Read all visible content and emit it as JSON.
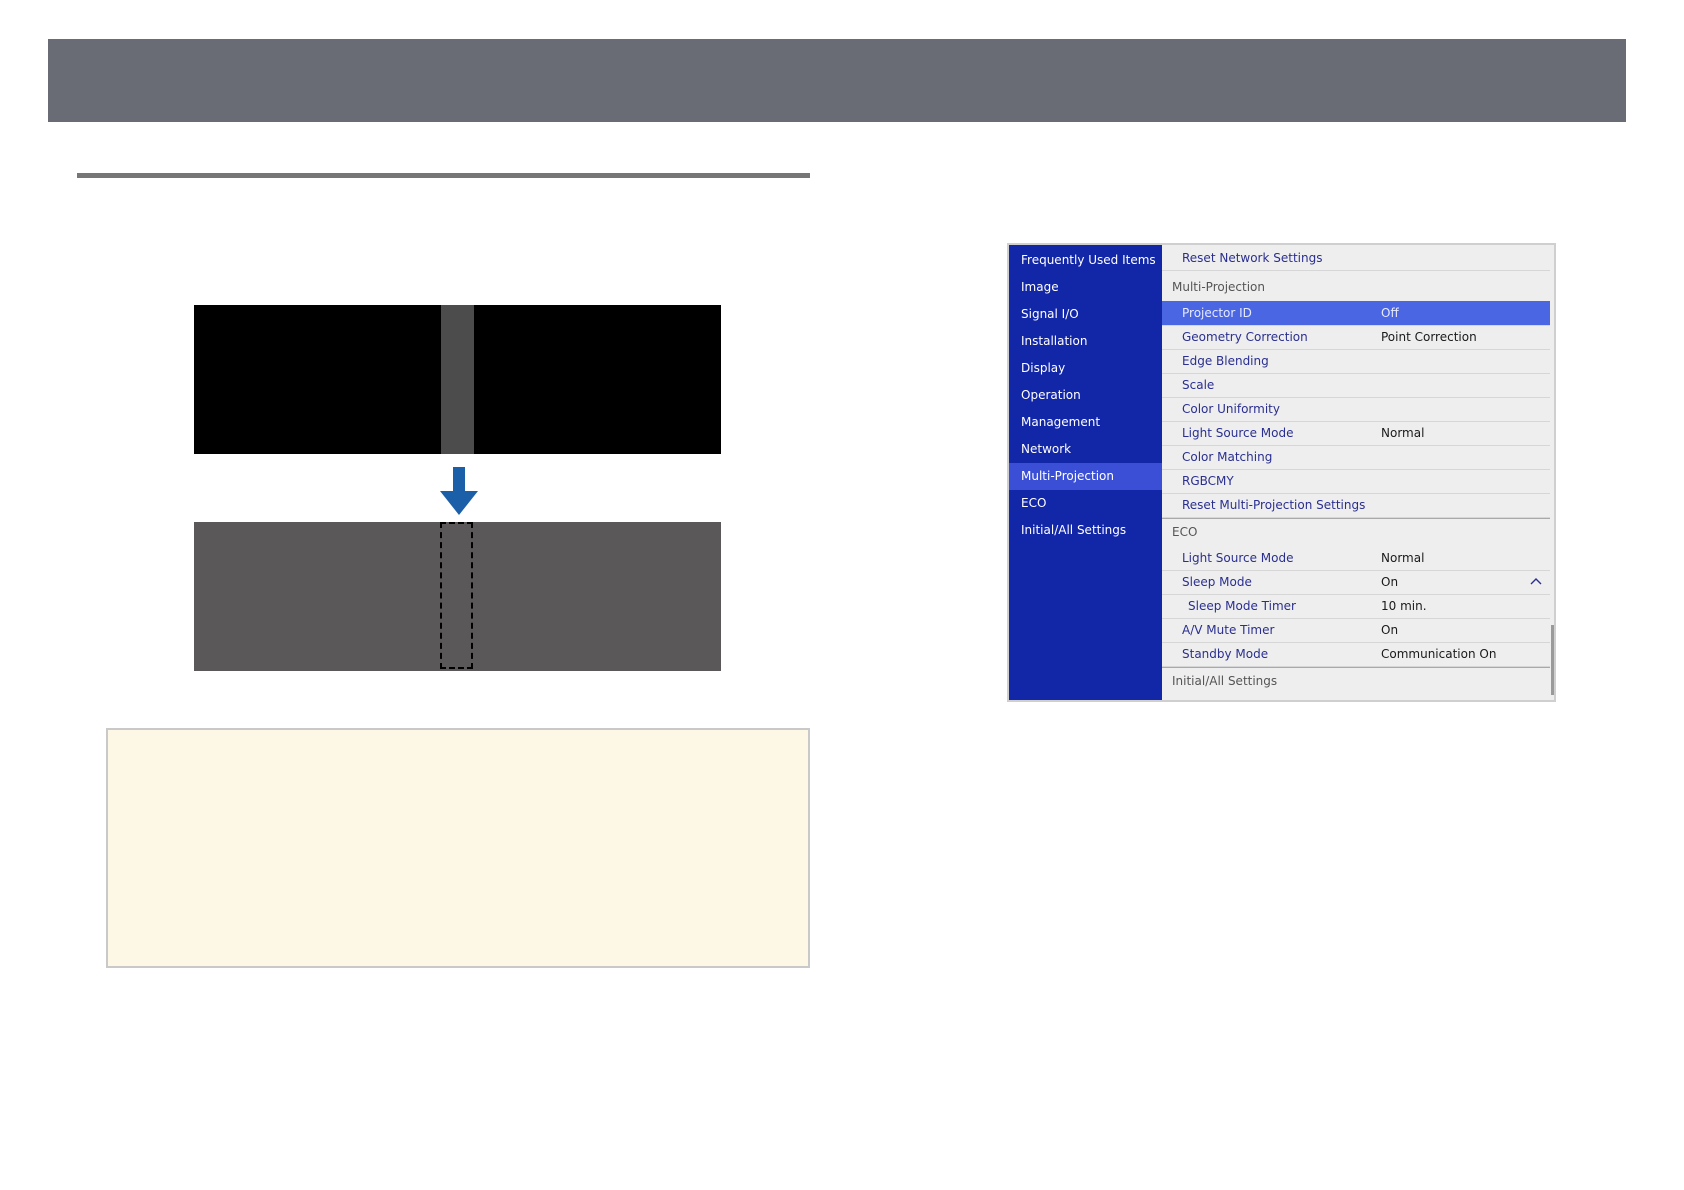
{
  "header": {
    "title": ""
  },
  "menu": {
    "nav": [
      {
        "label": "Frequently Used Items"
      },
      {
        "label": "Image"
      },
      {
        "label": "Signal I/O"
      },
      {
        "label": "Installation"
      },
      {
        "label": "Display"
      },
      {
        "label": "Operation"
      },
      {
        "label": "Management"
      },
      {
        "label": "Network"
      },
      {
        "label": "Multi-Projection",
        "active": true
      },
      {
        "label": "ECO"
      },
      {
        "label": "Initial/All Settings"
      }
    ],
    "items": {
      "reset_network": {
        "label": "Reset Network Settings"
      },
      "multi_projection_header": "Multi-Projection",
      "projector_id": {
        "label": "Projector ID",
        "value": "Off"
      },
      "geometry_correction": {
        "label": "Geometry Correction",
        "value": "Point Correction"
      },
      "edge_blending": {
        "label": "Edge Blending"
      },
      "scale": {
        "label": "Scale"
      },
      "color_uniformity": {
        "label": "Color Uniformity"
      },
      "light_source_mode_mp": {
        "label": "Light Source Mode",
        "value": "Normal"
      },
      "color_matching": {
        "label": "Color Matching"
      },
      "rgbcmy": {
        "label": "RGBCMY"
      },
      "reset_multi_projection": {
        "label": "Reset Multi-Projection Settings"
      },
      "eco_header": "ECO",
      "light_source_mode_eco": {
        "label": "Light Source Mode",
        "value": "Normal"
      },
      "sleep_mode": {
        "label": "Sleep Mode",
        "value": "On"
      },
      "sleep_mode_timer": {
        "label": "Sleep Mode Timer",
        "value": "10 min."
      },
      "av_mute_timer": {
        "label": "A/V Mute Timer",
        "value": "On"
      },
      "standby_mode": {
        "label": "Standby Mode",
        "value": "Communication On"
      },
      "initial_all_header": "Initial/All Settings"
    }
  },
  "colors": {
    "nav_bg": "#1226a8",
    "nav_active": "#3a4fd6",
    "highlight_row": "#4a66e3",
    "arrow": "#1a5fa8",
    "note_bg": "#fdf8e6",
    "topbar": "#6a6c75"
  },
  "icons": {
    "arrow": "arrow-down-icon",
    "expand": "chevron-up-icon"
  }
}
